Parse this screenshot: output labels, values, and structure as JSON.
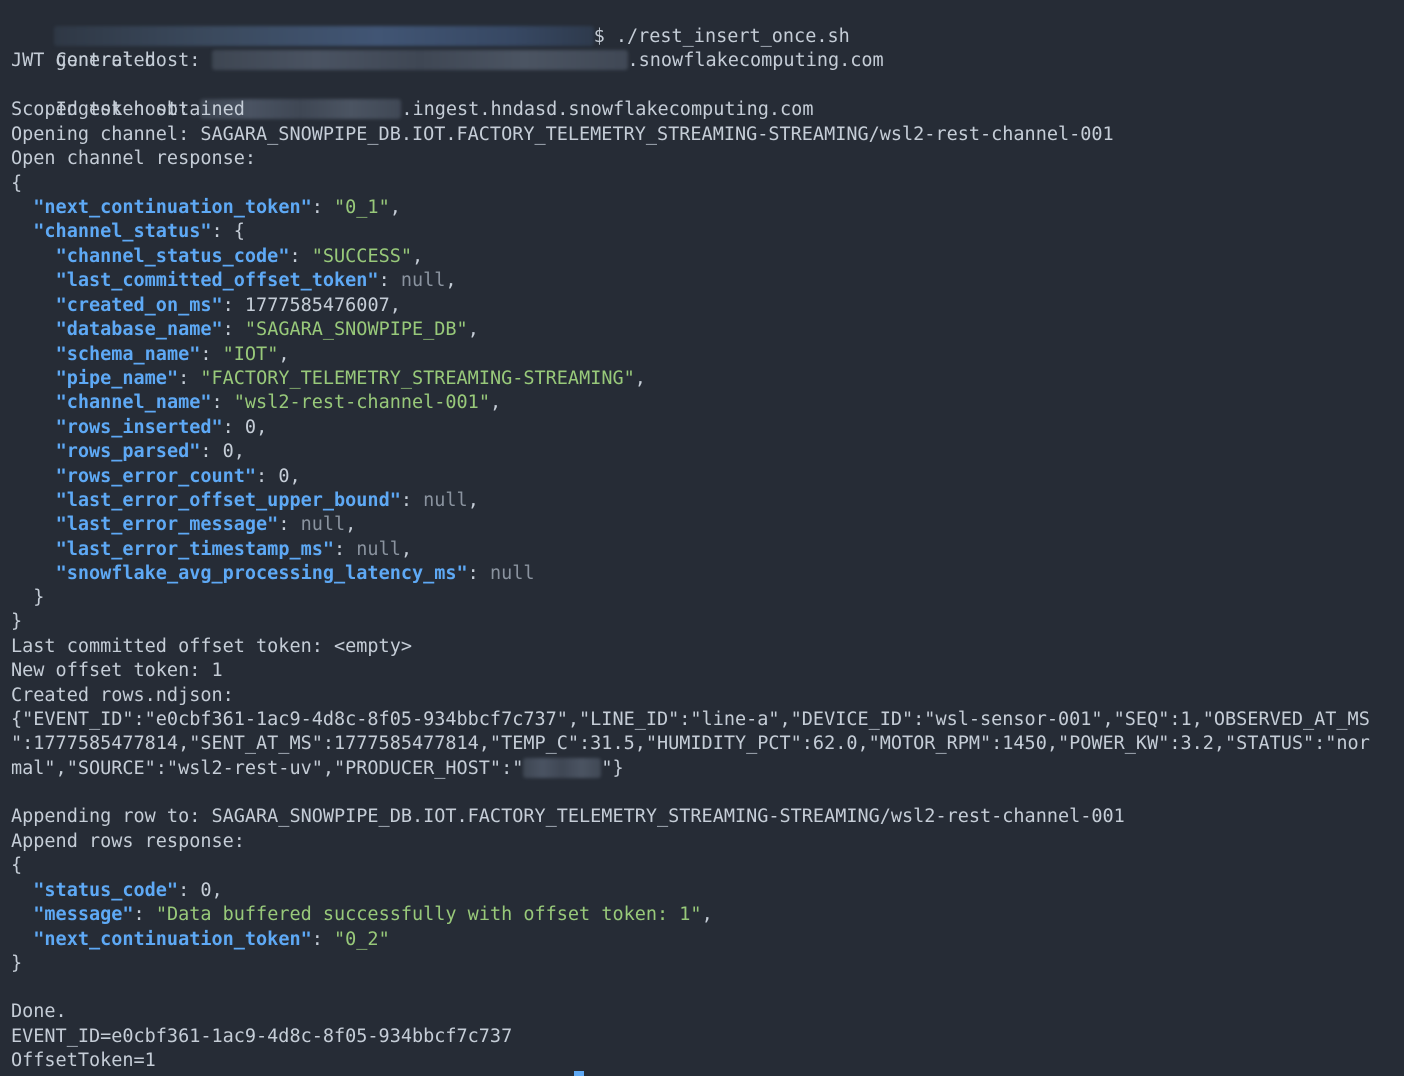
{
  "prompt": {
    "symbol": "$",
    "command": "./rest_insert_once.sh"
  },
  "control_host": {
    "label": "Control host:",
    "suffix": ".snowflakecomputing.com"
  },
  "jwt": "JWT generated",
  "ingest_host": {
    "label": "Ingest host:",
    "suffix": ".ingest.hndasd.snowflakecomputing.com"
  },
  "scoped": "Scoped token obtained",
  "opening": "Opening channel: SAGARA_SNOWPIPE_DB.IOT.FACTORY_TELEMETRY_STREAMING-STREAMING/wsl2-rest-channel-001",
  "open_resp_label": "Open channel response:",
  "open_resp": {
    "next_token_key": "\"next_continuation_token\"",
    "next_token_val": "\"0_1\"",
    "status_key": "\"channel_status\"",
    "fields": [
      {
        "key": "\"channel_status_code\"",
        "val": "\"SUCCESS\"",
        "type": "s",
        "comma": ","
      },
      {
        "key": "\"last_committed_offset_token\"",
        "val": "null",
        "type": "nul",
        "comma": ","
      },
      {
        "key": "\"created_on_ms\"",
        "val": "1777585476007",
        "type": "n",
        "comma": ","
      },
      {
        "key": "\"database_name\"",
        "val": "\"SAGARA_SNOWPIPE_DB\"",
        "type": "s",
        "comma": ","
      },
      {
        "key": "\"schema_name\"",
        "val": "\"IOT\"",
        "type": "s",
        "comma": ","
      },
      {
        "key": "\"pipe_name\"",
        "val": "\"FACTORY_TELEMETRY_STREAMING-STREAMING\"",
        "type": "s",
        "comma": ","
      },
      {
        "key": "\"channel_name\"",
        "val": "\"wsl2-rest-channel-001\"",
        "type": "s",
        "comma": ","
      },
      {
        "key": "\"rows_inserted\"",
        "val": "0",
        "type": "n",
        "comma": ","
      },
      {
        "key": "\"rows_parsed\"",
        "val": "0",
        "type": "n",
        "comma": ","
      },
      {
        "key": "\"rows_error_count\"",
        "val": "0",
        "type": "n",
        "comma": ","
      },
      {
        "key": "\"last_error_offset_upper_bound\"",
        "val": "null",
        "type": "nul",
        "comma": ","
      },
      {
        "key": "\"last_error_message\"",
        "val": "null",
        "type": "nul",
        "comma": ","
      },
      {
        "key": "\"last_error_timestamp_ms\"",
        "val": "null",
        "type": "nul",
        "comma": ","
      },
      {
        "key": "\"snowflake_avg_processing_latency_ms\"",
        "val": "null",
        "type": "nul",
        "comma": ""
      }
    ]
  },
  "last_committed": "Last committed offset token: <empty>",
  "new_offset": "New offset token: 1",
  "created_rows": "Created rows.ndjson:",
  "ndjson": {
    "line1": "{\"EVENT_ID\":\"e0cbf361-1ac9-4d8c-8f05-934bbcf7c737\",\"LINE_ID\":\"line-a\",\"DEVICE_ID\":\"wsl-sensor-001\",\"SEQ\":1,\"OBSERVED_AT_MS",
    "line2": "\":1777585477814,\"SENT_AT_MS\":1777585477814,\"TEMP_C\":31.5,\"HUMIDITY_PCT\":62.0,\"MOTOR_RPM\":1450,\"POWER_KW\":3.2,\"STATUS\":\"nor",
    "line3_pre": "mal\",\"SOURCE\":\"wsl2-rest-uv\",\"PRODUCER_HOST\":\"",
    "line3_post": "\"}"
  },
  "appending": "Appending row to: SAGARA_SNOWPIPE_DB.IOT.FACTORY_TELEMETRY_STREAMING-STREAMING/wsl2-rest-channel-001",
  "append_resp_label": "Append rows response:",
  "append_resp": [
    {
      "key": "\"status_code\"",
      "val": "0",
      "type": "n",
      "comma": ","
    },
    {
      "key": "\"message\"",
      "val": "\"Data buffered successfully with offset token: 1\"",
      "type": "s",
      "comma": ","
    },
    {
      "key": "\"next_continuation_token\"",
      "val": "\"0_2\"",
      "type": "s",
      "comma": ""
    }
  ],
  "done": "Done.",
  "event_id_line": "EVENT_ID=e0cbf361-1ac9-4d8c-8f05-934bbcf7c737",
  "offset_line": "OffsetToken=1",
  "colors": {
    "background": "#262c36",
    "text": "#c5cdd7",
    "json_key": "#5ea9f5",
    "json_string": "#98c97a",
    "json_null": "#8a939f"
  }
}
